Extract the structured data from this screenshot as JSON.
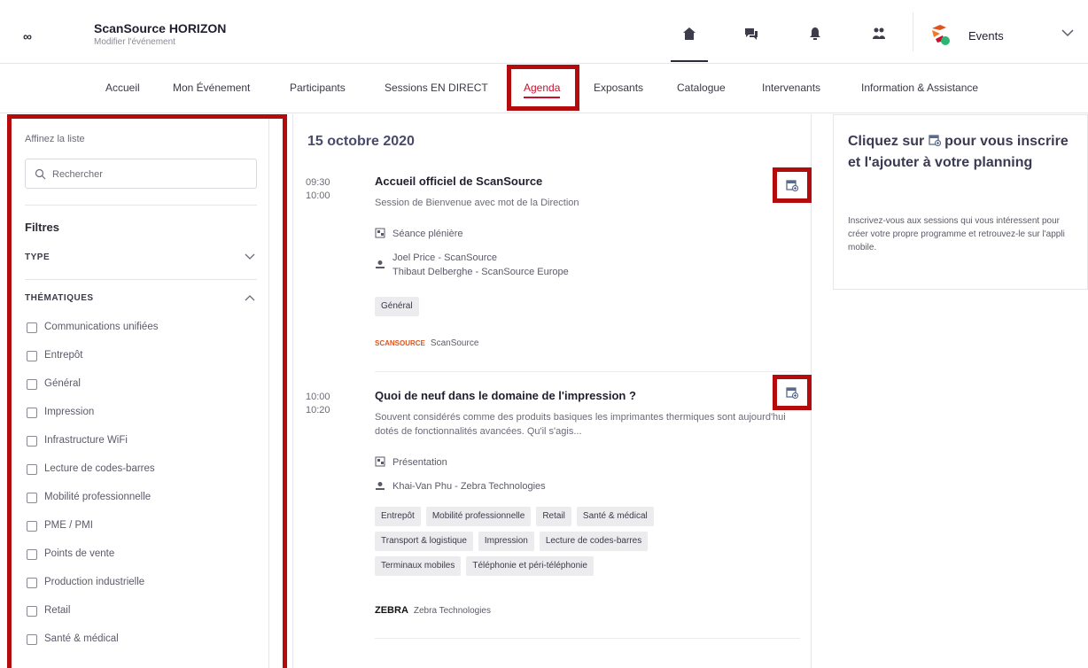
{
  "header": {
    "brand_mark": "∞",
    "app_title": "ScanSource HORIZON",
    "subtitle": "Modifier l'événement",
    "icons": [
      "home-icon",
      "chat-icon",
      "bell-icon",
      "people-icon"
    ],
    "events_label": "Events",
    "colors": {
      "accent": "#c8102e",
      "highlight_border": "#b40c0c",
      "logo_orange": "#e0531c",
      "logo_green": "#2bb673"
    }
  },
  "nav": {
    "items": [
      {
        "label": "Accueil"
      },
      {
        "label": "Mon Événement"
      },
      {
        "label": "Participants"
      },
      {
        "label": "Sessions EN DIRECT"
      },
      {
        "label": "Agenda"
      },
      {
        "label": "Exposants"
      },
      {
        "label": "Catalogue"
      },
      {
        "label": "Intervenants"
      },
      {
        "label": "Information & Assistance"
      }
    ],
    "active": "Agenda"
  },
  "sidebar": {
    "refine_label": "Affinez la liste",
    "search_placeholder": "Rechercher",
    "filters_title": "Filtres",
    "type_label": "TYPE",
    "themes_label": "THÉMATIQUES",
    "themes": [
      "Communications unifiées",
      "Entrepôt",
      "Général",
      "Impression",
      "Infrastructure WiFi",
      "Lecture de codes-barres",
      "Mobilité professionnelle",
      "PME / PMI",
      "Points de vente",
      "Production industrielle",
      "Retail",
      "Santé & médical"
    ]
  },
  "main": {
    "date": "15 octobre 2020",
    "sessions": [
      {
        "start": "09:30",
        "end": "10:00",
        "title": "Accueil officiel de ScanSource",
        "description": "Session de Bienvenue avec mot de la Direction",
        "type": "Séance plénière",
        "speakers": [
          "Joel Price - ScanSource",
          "Thibaut Delberghe - ScanSource Europe"
        ],
        "tags": [
          "Général"
        ],
        "company_logo": "SCANSOURCE",
        "company": "ScanSource"
      },
      {
        "start": "10:00",
        "end": "10:20",
        "title": "Quoi de neuf dans le domaine de l'impression ?",
        "description": "Souvent considérés comme des produits basiques les imprimantes thermiques sont aujourd'hui dotés de fonctionnalités avancées. Qu'il s'agis...",
        "type": "Présentation",
        "speakers": [
          "Khai-Van Phu - Zebra Technologies"
        ],
        "tags": [
          "Entrepôt",
          "Mobilité professionnelle",
          "Retail",
          "Santé & médical",
          "Transport & logistique",
          "Impression",
          "Lecture de codes-barres",
          "Terminaux mobiles",
          "Téléphonie et péri-téléphonie"
        ],
        "company_logo": "ZEBRA",
        "company": "Zebra Technologies"
      }
    ]
  },
  "info_card": {
    "title_before": "Cliquez sur",
    "title_after": "pour vous inscrire et l'ajouter à votre planning",
    "text": "Inscrivez-vous aux sessions qui vous intéressent pour créer votre propre programme et retrouvez-le sur l'appli mobile."
  }
}
